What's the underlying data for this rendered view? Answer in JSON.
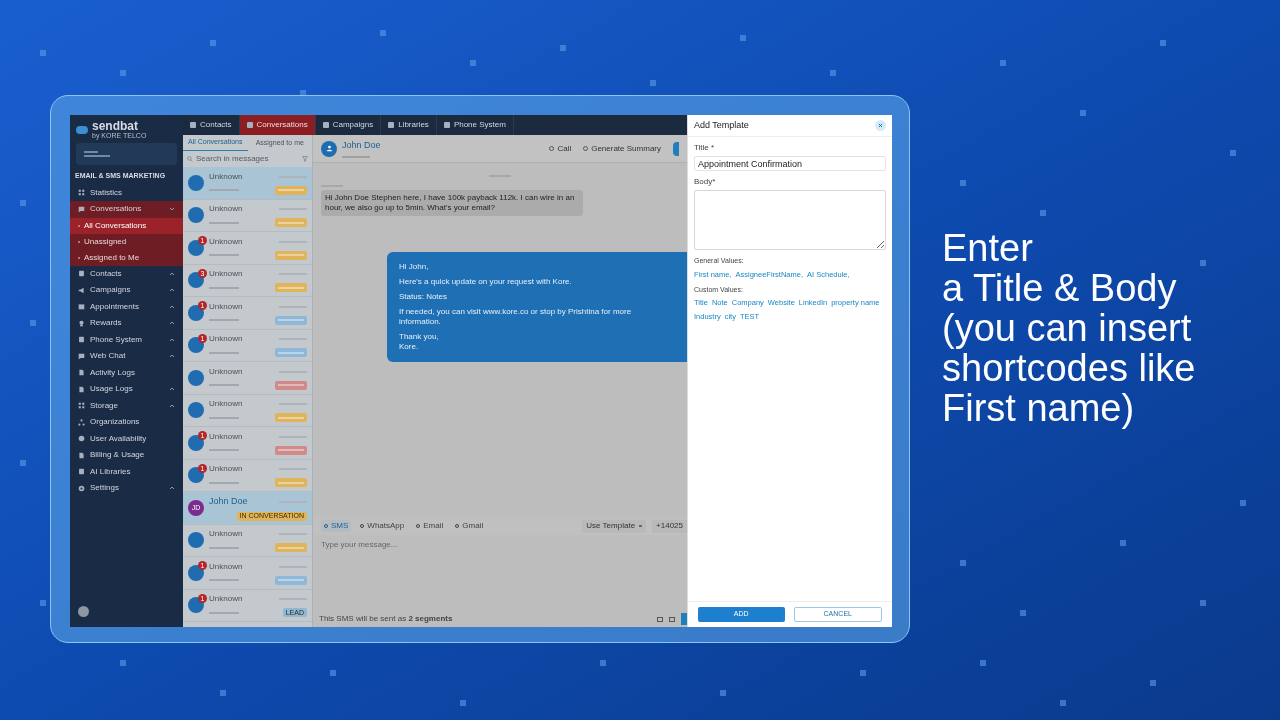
{
  "caption": [
    "Enter",
    "a Title & Body",
    "(you can insert",
    "shortcodes like",
    "First name)"
  ],
  "app": {
    "logo": "sendbat",
    "logo_sub": "by KORE TELCO",
    "section_title": "EMAIL & SMS MARKETING",
    "sidebar": [
      {
        "label": "Statistics",
        "selected": false
      },
      {
        "label": "Conversations",
        "selected": true,
        "expanded": true,
        "children": [
          {
            "label": "All Conversations",
            "selected": true
          },
          {
            "label": "Unassigned",
            "selected": false
          },
          {
            "label": "Assigned to Me",
            "selected": false
          }
        ]
      },
      {
        "label": "Contacts",
        "selected": false,
        "expanded": false
      },
      {
        "label": "Campaigns",
        "selected": false,
        "expanded": false
      },
      {
        "label": "Appointments",
        "selected": false,
        "expanded": false
      },
      {
        "label": "Rewards",
        "selected": false,
        "expanded": false
      },
      {
        "label": "Phone System",
        "selected": false,
        "expanded": false
      },
      {
        "label": "Web Chat",
        "selected": false,
        "expanded": false
      },
      {
        "label": "Activity Logs",
        "selected": false
      },
      {
        "label": "Usage Logs",
        "selected": false,
        "expanded": false
      },
      {
        "label": "Storage",
        "selected": false,
        "expanded": false
      },
      {
        "label": "Organizations",
        "selected": false
      },
      {
        "label": "User Availability",
        "selected": false
      },
      {
        "label": "Billing & Usage",
        "selected": false
      },
      {
        "label": "AI Libraries",
        "selected": false
      },
      {
        "label": "Settings",
        "selected": false,
        "expanded": false
      }
    ],
    "top_tabs": [
      {
        "label": "Contacts",
        "selected": false
      },
      {
        "label": "Conversations",
        "selected": true
      },
      {
        "label": "Campaigns",
        "selected": false
      },
      {
        "label": "Libraries",
        "selected": false
      },
      {
        "label": "Phone System",
        "selected": false
      }
    ],
    "list_tabs": [
      {
        "label": "All Conversations",
        "selected": true
      },
      {
        "label": "Assigned to me",
        "selected": false
      }
    ],
    "search": {
      "placeholder": "Search in messages"
    },
    "conversations": [
      {
        "name": "Unknown",
        "selected": true,
        "color": "#e0b45a"
      },
      {
        "name": "Unknown",
        "selected": false,
        "color": "#e0b45a"
      },
      {
        "name": "Unknown",
        "selected": false,
        "unread": "1",
        "color": "#e0b45a"
      },
      {
        "name": "Unknown",
        "selected": false,
        "unread": "3",
        "color": "#e0b45a"
      },
      {
        "name": "Unknown",
        "selected": false,
        "unread": "1",
        "color": "#8fb8d8"
      },
      {
        "name": "Unknown",
        "selected": false,
        "unread": "1",
        "color": "#8fb8d8"
      },
      {
        "name": "Unknown",
        "selected": false,
        "color": "#d08a8a"
      },
      {
        "name": "Unknown",
        "selected": false,
        "color": "#e0b45a"
      },
      {
        "name": "Unknown",
        "selected": false,
        "unread": "1",
        "color": "#d08a8a"
      },
      {
        "name": "Unknown",
        "selected": false,
        "unread": "1",
        "color": "#e0b45a"
      },
      {
        "name": "John Doe",
        "initials": "JD",
        "selected": true,
        "tag": "IN CONVERSATION",
        "color": "#e0b45a"
      },
      {
        "name": "Unknown",
        "selected": false,
        "color": "#e0b45a"
      },
      {
        "name": "Unknown",
        "selected": false,
        "unread": "1",
        "color": "#8fb8d8"
      },
      {
        "name": "Unknown",
        "selected": false,
        "unread": "1",
        "tag": "LEAD",
        "color": "#8fb8d8"
      }
    ],
    "chat": {
      "contact": "John Doe",
      "header_buttons": [
        "Call",
        "Generate Summary"
      ],
      "incoming": "Hi John Doe  Stephen here, I have 100k payback 112k. I can wire in an hour, we also go up to 5min. What's your email?",
      "outgoing": [
        "Hi John,",
        "Here's a quick update on your request with Kore.",
        "Status: Notes",
        "If needed, you can visit www.kore.co or stop by Prishtina for more information.",
        "Thank you,\nKore."
      ],
      "channels": [
        {
          "label": "SMS",
          "selected": true
        },
        {
          "label": "WhatsApp",
          "selected": false
        },
        {
          "label": "Email",
          "selected": false
        },
        {
          "label": "Gmail",
          "selected": false
        }
      ],
      "use_template": "Use Template",
      "from_number": "+14025",
      "composer": {
        "placeholder": "Type your message..."
      },
      "segments_note": "This SMS will be sent as **2 segments**"
    },
    "modal": {
      "title": "Add Template",
      "title_label": "Title *",
      "title_value": "Appointment Confirmation",
      "body_label": "Body*",
      "general_label": "General Values:",
      "general_values": [
        "First name,",
        "AssigneeFirstName,",
        "AI Schedule,"
      ],
      "custom_label": "Custom Values:",
      "custom_values": [
        "Title",
        "Note",
        "Company",
        "Website",
        "LinkedIn",
        "property name",
        "Industry",
        "city",
        "TEST"
      ],
      "buttons": [
        {
          "label": "ADD",
          "kind": "primary"
        },
        {
          "label": "CANCEL",
          "kind": "secondary"
        }
      ]
    }
  }
}
